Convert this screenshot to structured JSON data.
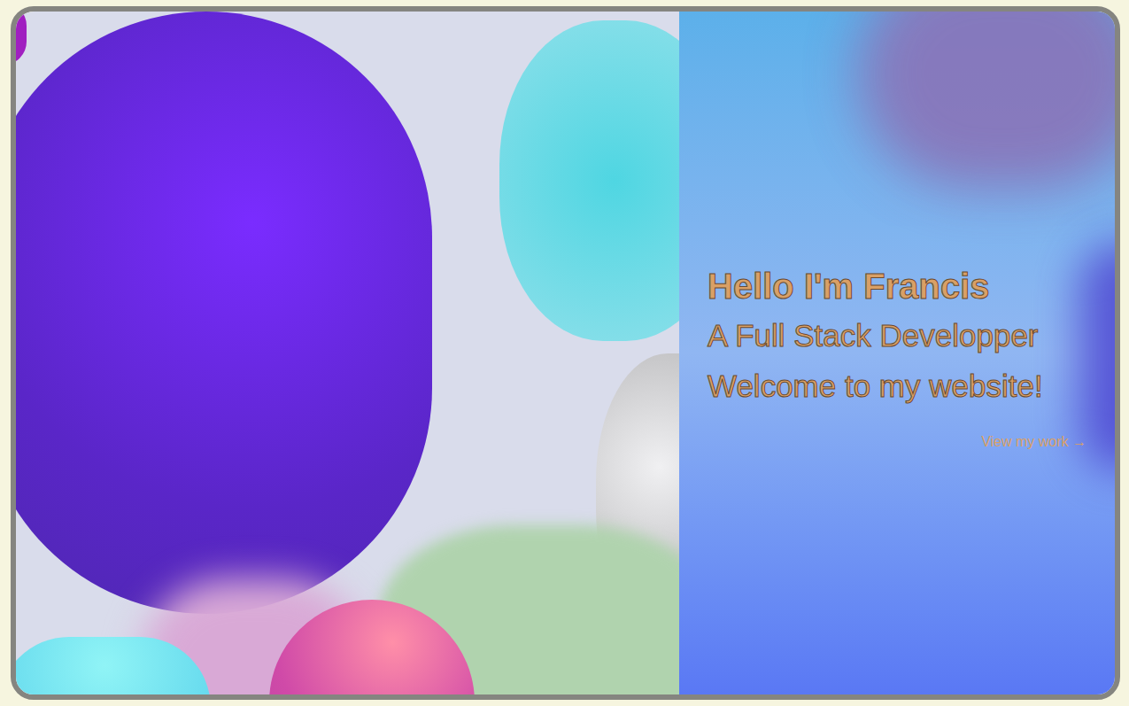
{
  "hero": {
    "greeting": "Hello I'm Francis",
    "subtitle": "A Full Stack Developper",
    "welcome": "Welcome to my website!",
    "link": "View my work →"
  }
}
